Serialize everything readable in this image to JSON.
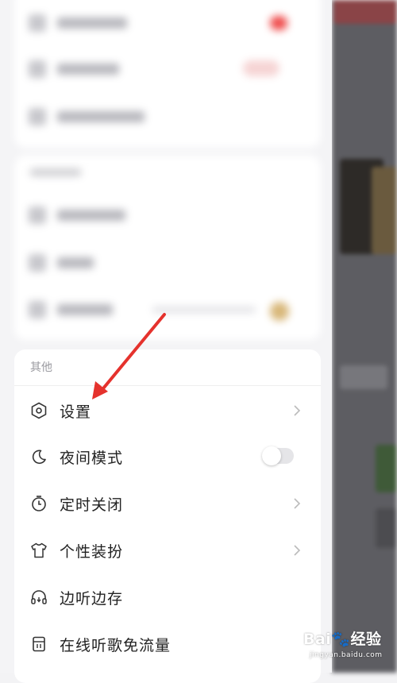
{
  "section": {
    "title": "其他"
  },
  "menu": [
    {
      "label": "设置",
      "icon": "hexagon-settings-icon",
      "control": "chevron"
    },
    {
      "label": "夜间模式",
      "icon": "moon-icon",
      "control": "toggle",
      "toggle_on": false
    },
    {
      "label": "定时关闭",
      "icon": "timer-icon",
      "control": "chevron"
    },
    {
      "label": "个性装扮",
      "icon": "tshirt-icon",
      "control": "chevron"
    },
    {
      "label": "边听边存",
      "icon": "headphones-download-icon",
      "control": "none"
    },
    {
      "label": "在线听歌免流量",
      "icon": "sim-card-icon",
      "control": "none"
    }
  ],
  "annotation": {
    "arrow_color": "#e5322d",
    "points_to": "设置"
  },
  "watermark": {
    "brand": "Bai",
    "brand_suffix": "经验",
    "site": "jingyan.baidu.com"
  },
  "colors": {
    "accent_red": "#e5322d",
    "text": "#222222",
    "muted": "#9a9aa0"
  }
}
